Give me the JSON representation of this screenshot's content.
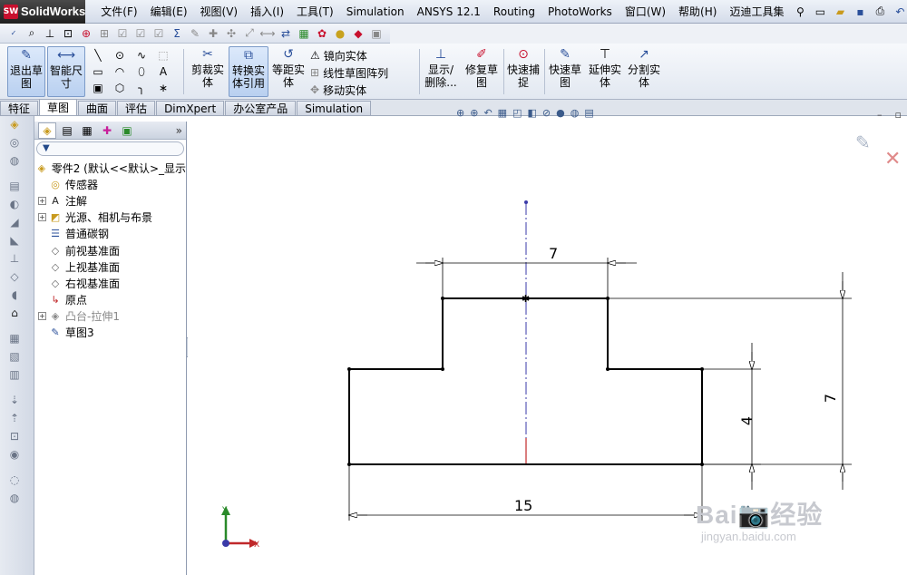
{
  "app": {
    "logo_mark": "SW",
    "logo_text": "SolidWorks"
  },
  "menu": [
    "文件(F)",
    "编辑(E)",
    "视图(V)",
    "插入(I)",
    "工具(T)",
    "Simulation",
    "ANSYS 12.1",
    "Routing",
    "PhotoWorks",
    "窗口(W)",
    "帮助(H)",
    "迈迪工具集"
  ],
  "command_manager": {
    "exit_sketch": [
      "退出草",
      "图"
    ],
    "smart_dim": [
      "智能尺",
      "寸"
    ],
    "trim": [
      "剪裁实",
      "体"
    ],
    "convert": [
      "转换实",
      "体引用"
    ],
    "offset": [
      "等距实",
      "体"
    ],
    "mirror": "镜向实体",
    "linear_pattern": "线性草图阵列",
    "move": "移动实体",
    "display_delete": [
      "显示/",
      "删除..."
    ],
    "repair": [
      "修复草",
      "图"
    ],
    "snap": [
      "快速捕",
      "捉"
    ],
    "quick_sketch": [
      "快速草",
      "图"
    ],
    "extend": [
      "延伸实",
      "体"
    ],
    "split": [
      "分割实",
      "体"
    ]
  },
  "tabs": [
    "特征",
    "草图",
    "曲面",
    "评估",
    "DimXpert",
    "办公室产品",
    "Simulation"
  ],
  "active_tab": "草图",
  "tree": {
    "root": "零件2 (默认<<默认>_显示",
    "items": [
      {
        "label": "传感器",
        "icon": "sensor-icon",
        "expandable": false,
        "muted": false
      },
      {
        "label": "注解",
        "icon": "annotation-icon",
        "expandable": true,
        "muted": false
      },
      {
        "label": "光源、相机与布景",
        "icon": "lights-icon",
        "expandable": true,
        "muted": false
      },
      {
        "label": "普通碳钢",
        "icon": "material-icon",
        "expandable": false,
        "muted": false
      },
      {
        "label": "前视基准面",
        "icon": "plane-icon",
        "expandable": false,
        "muted": false
      },
      {
        "label": "上视基准面",
        "icon": "plane-icon",
        "expandable": false,
        "muted": false
      },
      {
        "label": "右视基准面",
        "icon": "plane-icon",
        "expandable": false,
        "muted": false
      },
      {
        "label": "原点",
        "icon": "origin-icon",
        "expandable": false,
        "muted": false
      },
      {
        "label": "凸台-拉伸1",
        "icon": "extrude-icon",
        "expandable": true,
        "muted": true
      },
      {
        "label": "草图3",
        "icon": "sketch-icon",
        "expandable": false,
        "muted": false
      }
    ]
  },
  "sketch": {
    "dim_top": "7",
    "dim_bottom": "15",
    "dim_height_step": "4",
    "dim_height_total": "7"
  },
  "triad": {
    "x": "X",
    "y": "Y"
  },
  "watermark": {
    "main": "Bai📷经验",
    "sub": "jingyan.baidu.com"
  },
  "colors": {
    "accent": "#c8102e",
    "triad_x": "#c0282a",
    "triad_y": "#2a8a2a",
    "centerline": "#3a3aa8"
  }
}
